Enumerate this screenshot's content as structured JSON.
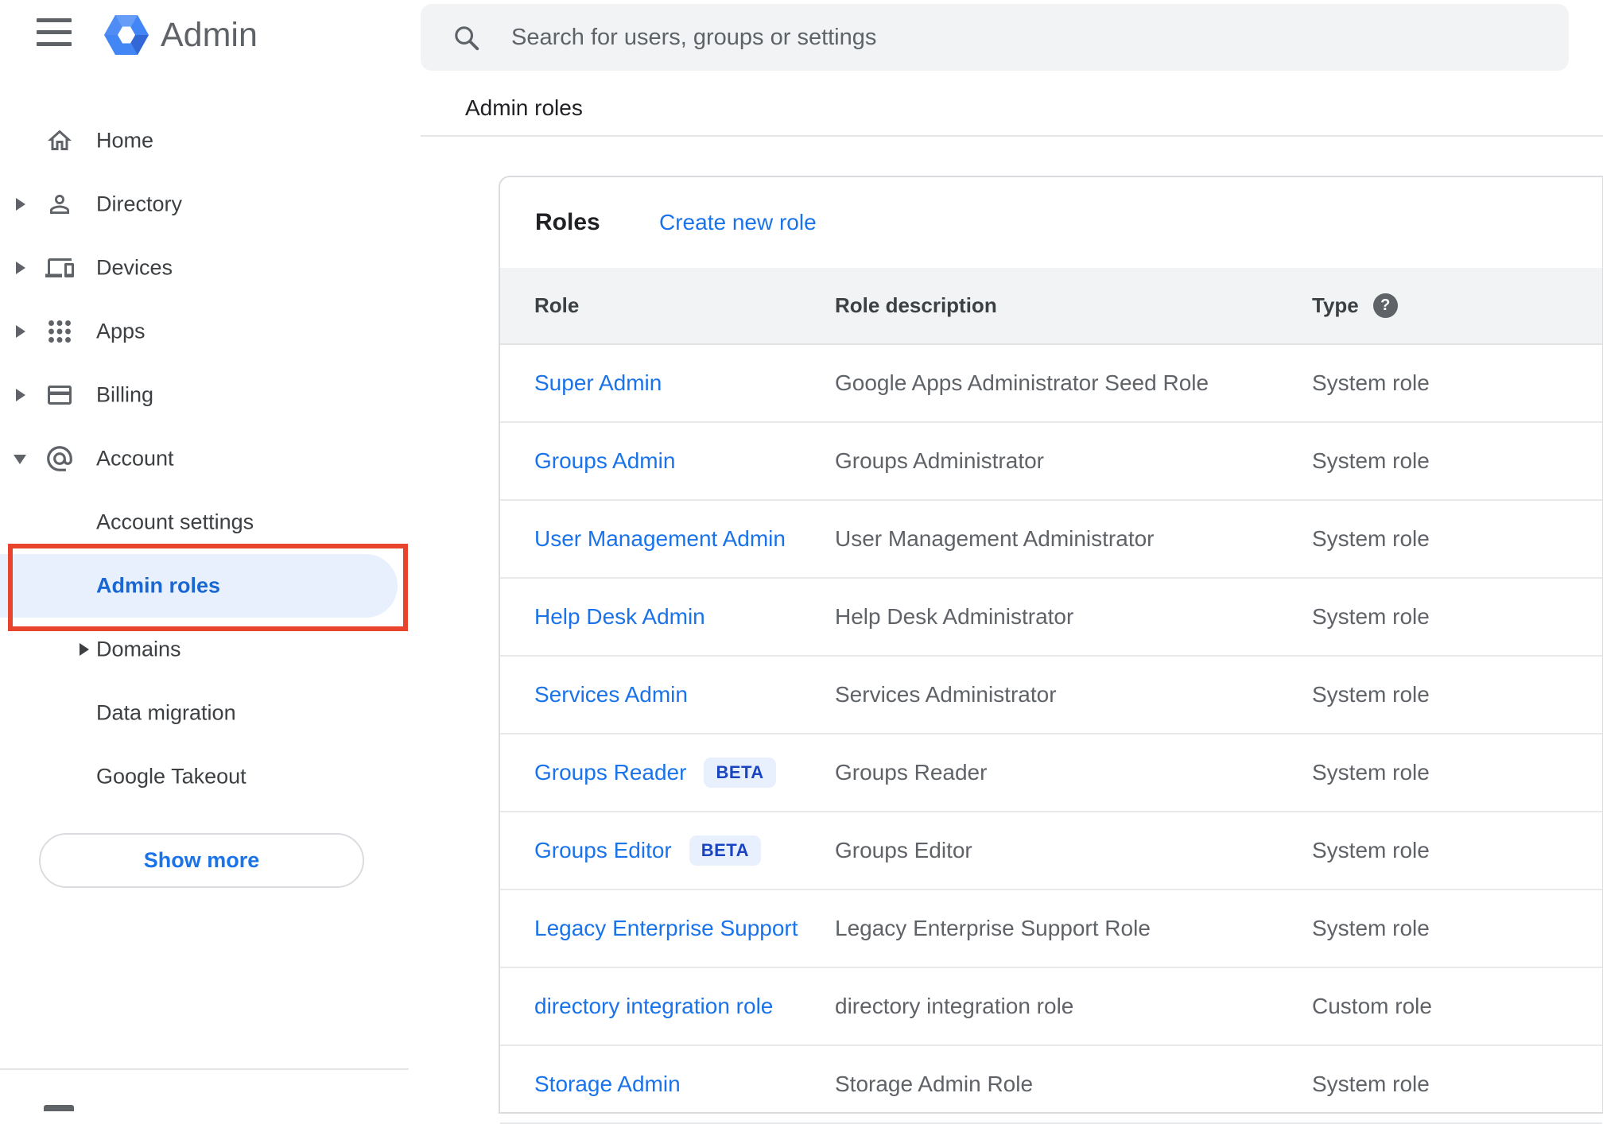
{
  "app": {
    "product_name": "Admin"
  },
  "search": {
    "placeholder": "Search for users, groups or settings"
  },
  "breadcrumb": "Admin roles",
  "sidebar": {
    "items": [
      {
        "label": "Home",
        "icon": "home-icon",
        "expandable": false
      },
      {
        "label": "Directory",
        "icon": "directory-icon",
        "expandable": true
      },
      {
        "label": "Devices",
        "icon": "devices-icon",
        "expandable": true
      },
      {
        "label": "Apps",
        "icon": "apps-icon",
        "expandable": true
      },
      {
        "label": "Billing",
        "icon": "billing-icon",
        "expandable": true
      },
      {
        "label": "Account",
        "icon": "account-icon",
        "expandable": true,
        "expanded": true
      }
    ],
    "sub_items": [
      {
        "label": "Account settings",
        "selected": false,
        "expandable": false
      },
      {
        "label": "Admin roles",
        "selected": true,
        "expandable": false,
        "annotated": true
      },
      {
        "label": "Domains",
        "selected": false,
        "expandable": true
      },
      {
        "label": "Data migration",
        "selected": false,
        "expandable": false
      },
      {
        "label": "Google Takeout",
        "selected": false,
        "expandable": false
      }
    ],
    "show_more_label": "Show more"
  },
  "main": {
    "section_title": "Roles",
    "create_link": "Create new role",
    "table": {
      "columns": [
        "Role",
        "Role description",
        "Type"
      ],
      "type_help_glyph": "?",
      "beta_label": "BETA",
      "rows": [
        {
          "role": "Super Admin",
          "beta": false,
          "description": "Google Apps Administrator Seed Role",
          "type": "System role"
        },
        {
          "role": "Groups Admin",
          "beta": false,
          "description": "Groups Administrator",
          "type": "System role"
        },
        {
          "role": "User Management Admin",
          "beta": false,
          "description": "User Management Administrator",
          "type": "System role"
        },
        {
          "role": "Help Desk Admin",
          "beta": false,
          "description": "Help Desk Administrator",
          "type": "System role"
        },
        {
          "role": "Services Admin",
          "beta": false,
          "description": "Services Administrator",
          "type": "System role"
        },
        {
          "role": "Groups Reader",
          "beta": true,
          "description": "Groups Reader",
          "type": "System role"
        },
        {
          "role": "Groups Editor",
          "beta": true,
          "description": "Groups Editor",
          "type": "System role"
        },
        {
          "role": "Legacy Enterprise Support",
          "beta": false,
          "description": "Legacy Enterprise Support Role",
          "type": "System role"
        },
        {
          "role": "directory integration role",
          "beta": false,
          "description": "directory integration role",
          "type": "Custom role"
        },
        {
          "role": "Storage Admin",
          "beta": false,
          "description": "Storage Admin Role",
          "type": "System role"
        }
      ]
    }
  },
  "colors": {
    "accent_blue": "#1a73e8",
    "selected_nav_bg": "#e8f0fe",
    "selected_nav_text": "#1967d2",
    "annotation_red": "#e8432d",
    "beta_badge_bg": "#e8f0fe",
    "beta_badge_text": "#1b44c0",
    "header_band_bg": "#f1f3f4",
    "search_bg": "#f1f3f4",
    "logo_blue": "#4285f4"
  }
}
